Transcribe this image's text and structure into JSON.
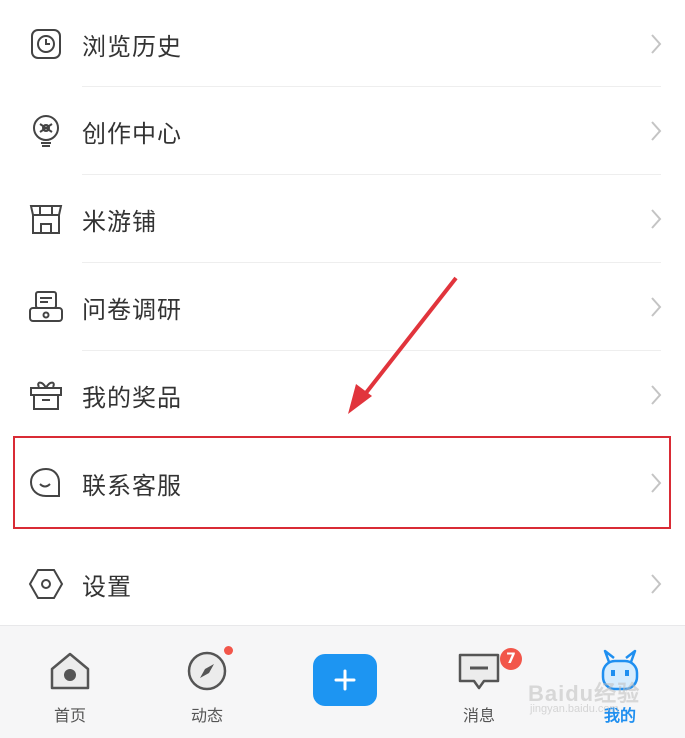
{
  "menu": {
    "items": [
      {
        "label": "浏览历史",
        "icon": "clock-icon"
      },
      {
        "label": "创作中心",
        "icon": "lightbulb-icon"
      },
      {
        "label": "米游铺",
        "icon": "store-icon"
      },
      {
        "label": "问卷调研",
        "icon": "survey-icon"
      },
      {
        "label": "我的奖品",
        "icon": "gift-icon"
      },
      {
        "label": "联系客服",
        "icon": "chat-bubble-icon"
      },
      {
        "label": "设置",
        "icon": "settings-hexagon-icon"
      }
    ],
    "highlighted_item": "联系客服"
  },
  "tabbar": {
    "tabs": [
      {
        "label": "首页",
        "icon": "home-icon"
      },
      {
        "label": "动态",
        "icon": "compass-icon",
        "has_dot": true
      },
      {
        "label": "",
        "icon": "plus-icon"
      },
      {
        "label": "消息",
        "icon": "message-icon",
        "badge": "7"
      },
      {
        "label": "我的",
        "icon": "mascot-icon",
        "active": true
      }
    ]
  },
  "watermark": {
    "text": "Baidu经验",
    "sub": "jingyan.baidu.com"
  },
  "colors": {
    "accent": "#1d95f2",
    "highlight_border": "#d92b35",
    "badge": "#f2564a"
  }
}
